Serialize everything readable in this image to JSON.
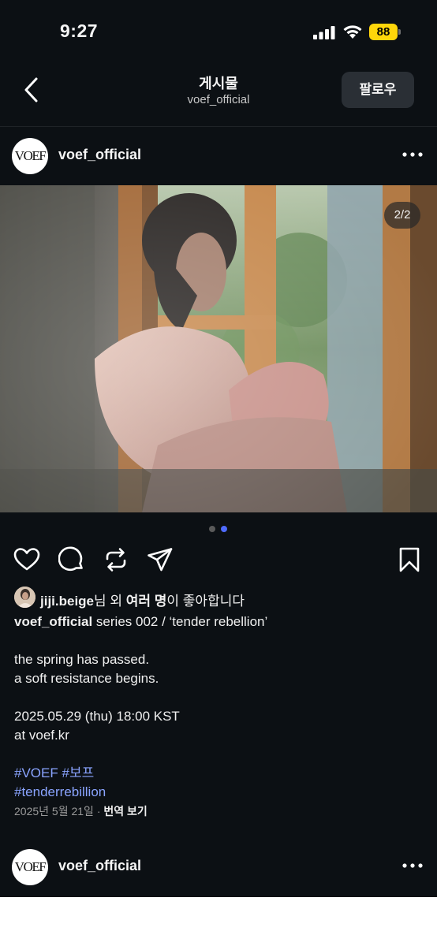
{
  "status_bar": {
    "time": "9:27",
    "battery": "88"
  },
  "nav": {
    "title": "게시물",
    "subtitle": "voef_official",
    "follow_label": "팔로우"
  },
  "post": {
    "avatar_text": "VOEF",
    "username": "voef_official",
    "image_counter": "2/2",
    "carousel": {
      "total": 2,
      "active": 2
    },
    "liked_by": {
      "user": "jiji.beige",
      "suffix1": "님 외 ",
      "others": "여러 명",
      "suffix2": "이 좋아합니다"
    },
    "caption": {
      "author": "voef_official",
      "title": " series 002 / ‘tender rebellion’",
      "line1": "the spring has passed.",
      "line2": "a soft resistance begins.",
      "line3": "2025.05.29 (thu) 18:00 KST",
      "line4": "at voef.kr",
      "hashtag1": "#VOEF",
      "hashtag2": "#보프",
      "hashtag3": "#tenderrebillion"
    },
    "date": "2025년 5월 21일",
    "separator": " · ",
    "translate_label": "번역 보기"
  },
  "next_post": {
    "avatar_text": "VOEF",
    "username": "voef_official"
  },
  "colors": {
    "background": "#0c1014",
    "hashtag": "#8aa4ff",
    "dot_active": "#4f6bff",
    "dot_inactive": "#5a5a5a",
    "battery": "#ffd60a"
  },
  "icons": [
    "signal-icon",
    "wifi-icon",
    "battery-icon",
    "back-icon",
    "more-icon",
    "heart-icon",
    "comment-icon",
    "repost-icon",
    "share-icon",
    "bookmark-icon"
  ]
}
